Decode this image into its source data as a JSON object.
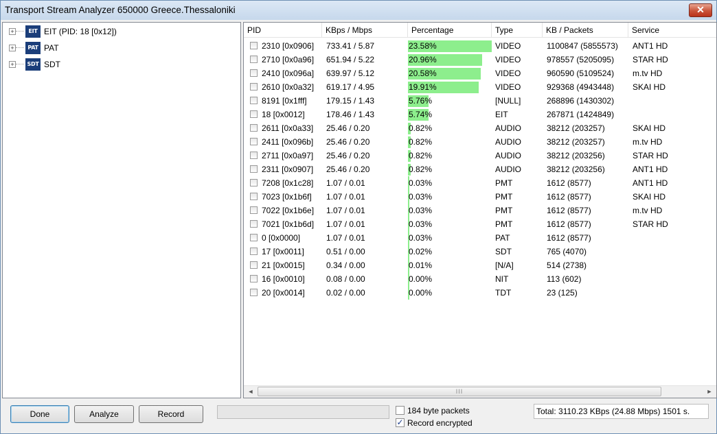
{
  "window": {
    "title": "Transport Stream Analyzer 650000 Greece.Thessaloniki",
    "close_glyph": "✕"
  },
  "tree": [
    {
      "icon": "EIT",
      "label": "EIT (PID: 18 [0x12])",
      "expander": "+"
    },
    {
      "icon": "PAT",
      "label": "PAT",
      "expander": "+"
    },
    {
      "icon": "SDT",
      "label": "SDT",
      "expander": "+"
    }
  ],
  "columns": [
    "PID",
    "KBps / Mbps",
    "Percentage",
    "Type",
    "KB / Packets",
    "Service"
  ],
  "rows": [
    {
      "pid": "2310 [0x0906]",
      "rate": "733.41 / 5.87",
      "pct": "23.58%",
      "pct_value": 23.58,
      "type": "VIDEO",
      "kb": "1100847 (5855573)",
      "service": "ANT1 HD"
    },
    {
      "pid": "2710 [0x0a96]",
      "rate": "651.94 / 5.22",
      "pct": "20.96%",
      "pct_value": 20.96,
      "type": "VIDEO",
      "kb": "978557 (5205095)",
      "service": "STAR HD"
    },
    {
      "pid": "2410 [0x096a]",
      "rate": "639.97 / 5.12",
      "pct": "20.58%",
      "pct_value": 20.58,
      "type": "VIDEO",
      "kb": "960590 (5109524)",
      "service": "m.tv HD"
    },
    {
      "pid": "2610 [0x0a32]",
      "rate": "619.17 / 4.95",
      "pct": "19.91%",
      "pct_value": 19.91,
      "type": "VIDEO",
      "kb": "929368 (4943448)",
      "service": "SKAI HD"
    },
    {
      "pid": "8191 [0x1fff]",
      "rate": "179.15 / 1.43",
      "pct": "5.76%",
      "pct_value": 5.76,
      "type": "[NULL]",
      "kb": "268896 (1430302)",
      "service": ""
    },
    {
      "pid": "18 [0x0012]",
      "rate": "178.46 / 1.43",
      "pct": "5.74%",
      "pct_value": 5.74,
      "type": "EIT",
      "kb": "267871 (1424849)",
      "service": ""
    },
    {
      "pid": "2611 [0x0a33]",
      "rate": "25.46 / 0.20",
      "pct": "0.82%",
      "pct_value": 0.82,
      "type": "AUDIO",
      "kb": "38212 (203257)",
      "service": "SKAI HD"
    },
    {
      "pid": "2411 [0x096b]",
      "rate": "25.46 / 0.20",
      "pct": "0.82%",
      "pct_value": 0.82,
      "type": "AUDIO",
      "kb": "38212 (203257)",
      "service": "m.tv HD"
    },
    {
      "pid": "2711 [0x0a97]",
      "rate": "25.46 / 0.20",
      "pct": "0.82%",
      "pct_value": 0.82,
      "type": "AUDIO",
      "kb": "38212 (203256)",
      "service": "STAR HD"
    },
    {
      "pid": "2311 [0x0907]",
      "rate": "25.46 / 0.20",
      "pct": "0.82%",
      "pct_value": 0.82,
      "type": "AUDIO",
      "kb": "38212 (203256)",
      "service": "ANT1 HD"
    },
    {
      "pid": "7208 [0x1c28]",
      "rate": "1.07 / 0.01",
      "pct": "0.03%",
      "pct_value": 0.03,
      "type": "PMT",
      "kb": "1612 (8577)",
      "service": "ANT1 HD"
    },
    {
      "pid": "7023 [0x1b6f]",
      "rate": "1.07 / 0.01",
      "pct": "0.03%",
      "pct_value": 0.03,
      "type": "PMT",
      "kb": "1612 (8577)",
      "service": "SKAI HD"
    },
    {
      "pid": "7022 [0x1b6e]",
      "rate": "1.07 / 0.01",
      "pct": "0.03%",
      "pct_value": 0.03,
      "type": "PMT",
      "kb": "1612 (8577)",
      "service": "m.tv HD"
    },
    {
      "pid": "7021 [0x1b6d]",
      "rate": "1.07 / 0.01",
      "pct": "0.03%",
      "pct_value": 0.03,
      "type": "PMT",
      "kb": "1612 (8577)",
      "service": "STAR HD"
    },
    {
      "pid": "0 [0x0000]",
      "rate": "1.07 / 0.01",
      "pct": "0.03%",
      "pct_value": 0.03,
      "type": "PAT",
      "kb": "1612 (8577)",
      "service": ""
    },
    {
      "pid": "17 [0x0011]",
      "rate": "0.51 / 0.00",
      "pct": "0.02%",
      "pct_value": 0.02,
      "type": "SDT",
      "kb": "765 (4070)",
      "service": ""
    },
    {
      "pid": "21 [0x0015]",
      "rate": "0.34 / 0.00",
      "pct": "0.01%",
      "pct_value": 0.01,
      "type": "[N/A]",
      "kb": "514 (2738)",
      "service": ""
    },
    {
      "pid": "16 [0x0010]",
      "rate": "0.08 / 0.00",
      "pct": "0.00%",
      "pct_value": 0.0,
      "type": "NIT",
      "kb": "113 (602)",
      "service": ""
    },
    {
      "pid": "20 [0x0014]",
      "rate": "0.02 / 0.00",
      "pct": "0.00%",
      "pct_value": 0.0,
      "type": "TDT",
      "kb": "23 (125)",
      "service": ""
    }
  ],
  "scrollbar": {
    "left_arrow": "◄",
    "right_arrow": "►",
    "grip": "III"
  },
  "buttons": {
    "done": "Done",
    "analyze": "Analyze",
    "record": "Record"
  },
  "options": {
    "byte184": {
      "label": "184 byte packets",
      "checked": false
    },
    "encrypted": {
      "label": "Record encrypted",
      "checked": true
    }
  },
  "status": "Total: 3110.23 KBps (24.88 Mbps) 1501 s.",
  "colors": {
    "bar": "#8dee8d",
    "title_bg": "#c6d8ec",
    "close": "#c9543b"
  }
}
